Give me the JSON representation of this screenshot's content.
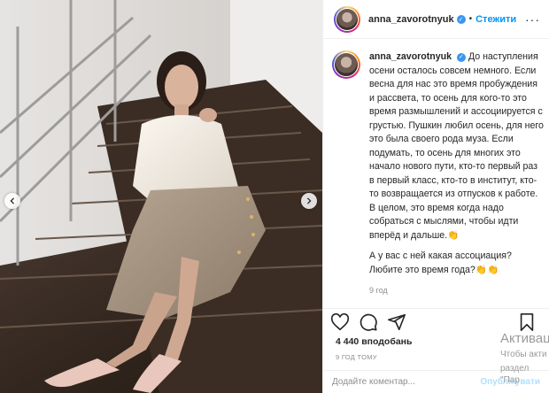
{
  "post": {
    "username": "anna_zavorotnyuk",
    "separator": "•",
    "follow_label": "Стежити",
    "more_label": "···",
    "caption_p1": "До наступления осени осталось совсем немного. Если весна для нас это время пробуждения и рассвета, то осень для кого-то это время размышлений и ассоциируется с грустью. Пушкин любил осень, для него это была своего рода муза. Если подумать, то осень для многих это начало нового пути, кто-то первый раз в первый класс, кто-то в институт, кто-то возвращается из отпусков к работе. В целом, это время когда надо собраться с мыслями, чтобы идти вперёд и дальше.",
    "caption_p2": "А у вас с ней какая ассоциация? Любите это время года?",
    "emoji1": "👏",
    "emoji2": "👏👏",
    "caption_time": "9 год",
    "likes": "4 440 вподобань",
    "date": "9 ГОД ТОМУ",
    "comment_placeholder": "Додайте коментар...",
    "publish_label": "Опублікувати"
  },
  "overlay": {
    "activate_title": "Активац",
    "activate_line1": "Чтобы акти",
    "activate_line2": "раздел \"Пар"
  },
  "icons": {
    "verified": "verified-badge-icon",
    "like": "heart-icon",
    "comment": "comment-icon",
    "share": "share-icon",
    "save": "bookmark-icon",
    "prev": "chevron-left-icon",
    "next": "chevron-right-icon"
  },
  "colors": {
    "link": "#0095f6",
    "verified": "#3897f0",
    "muted": "#8e8e8e"
  }
}
